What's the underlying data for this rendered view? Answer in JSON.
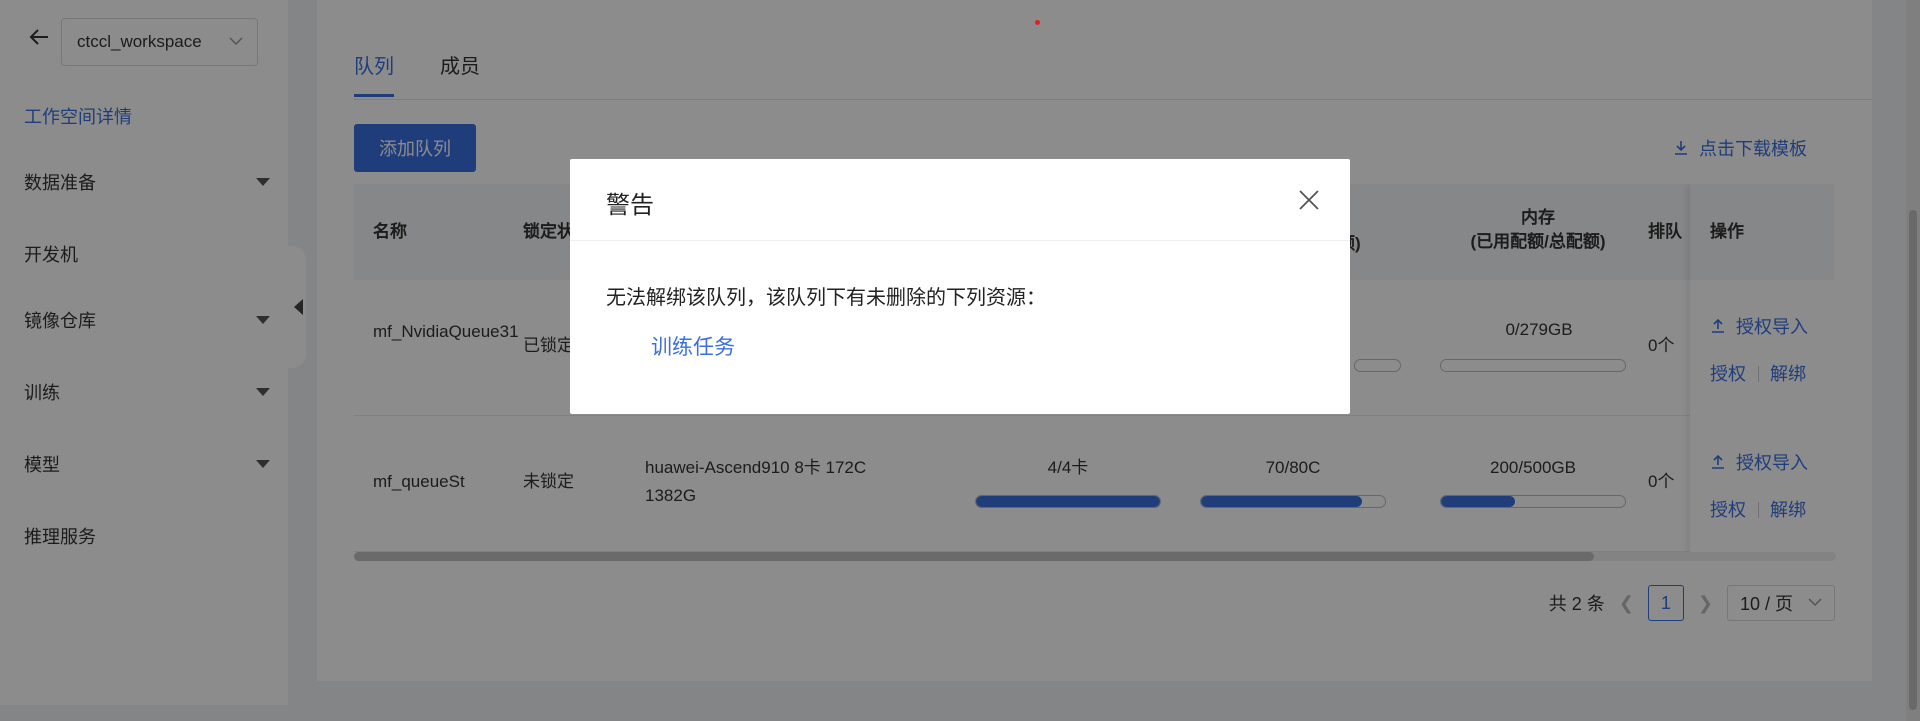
{
  "sidebar": {
    "workspace": "ctccl_workspace",
    "items": [
      {
        "label": "工作空间详情",
        "active": true,
        "has_caret": false
      },
      {
        "label": "数据准备",
        "active": false,
        "has_caret": true
      },
      {
        "label": "开发机",
        "active": false,
        "has_caret": false
      },
      {
        "label": "镜像仓库",
        "active": false,
        "has_caret": true
      },
      {
        "label": "训练",
        "active": false,
        "has_caret": true
      },
      {
        "label": "模型",
        "active": false,
        "has_caret": true
      },
      {
        "label": "推理服务",
        "active": false,
        "has_caret": false
      }
    ]
  },
  "tabs": [
    "队列",
    "成员"
  ],
  "toolbar": {
    "add_label": "添加队列",
    "download_label": "点击下载模板"
  },
  "table": {
    "headers": {
      "name": "名称",
      "lock": "锁定状",
      "quota_tail": "额)",
      "memory_line1": "内存",
      "memory_line2": "(已用配额/总配额)",
      "queue": "排队",
      "ops": "操作"
    },
    "rows": [
      {
        "name": "mf_NvidiaQueue31",
        "lock": "已锁定",
        "memory_text": "0/279GB",
        "memory_pct": 0,
        "queue": "0个",
        "import": "授权导入",
        "auth": "授权",
        "unbind": "解绑"
      },
      {
        "name": "mf_queueSt",
        "lock": "未锁定",
        "spec": "huawei-Ascend910 8卡 172C 1382G",
        "card_text": "4/4卡",
        "card_pct": 100,
        "cpu_text": "70/80C",
        "cpu_pct": 87.5,
        "memory_text": "200/500GB",
        "memory_pct": 40,
        "queue": "0个",
        "import": "授权导入",
        "auth": "授权",
        "unbind": "解绑"
      }
    ]
  },
  "pagination": {
    "total": "共 2 条",
    "current": "1",
    "page_size": "10 / 页"
  },
  "modal": {
    "title": "警告",
    "message": "无法解绑该队列，该队列下有未删除的下列资源：",
    "resource_link": "训练任务"
  },
  "colors": {
    "accent": "#3b6fe0",
    "overlay": "rgba(0,0,0,0.45)"
  }
}
